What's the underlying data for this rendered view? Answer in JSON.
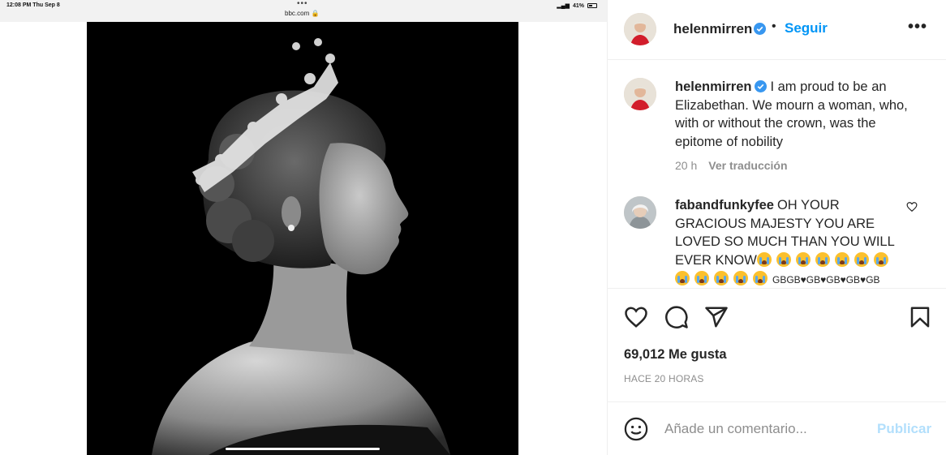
{
  "ipad": {
    "time": "12:08 PM   Thu Sep 8",
    "dots": "•••",
    "url": "bbc.com 🔒",
    "battery": "41%"
  },
  "header": {
    "username": "helenmirren",
    "bullet": "•",
    "follow_label": "Seguir",
    "more_label": "•••"
  },
  "caption": {
    "username": "helenmirren",
    "text": "I am proud to be an Elizabethan. We mourn a woman, who, with or without the crown, was the epitome of nobility",
    "time": "20 h",
    "translate_label": "Ver traducción"
  },
  "comment": {
    "username": "fabandfunkyfee",
    "text": "OH YOUR GRACIOUS MAJESTY YOU ARE LOVED SO MUCH THAN YOU WILL EVER KNOW",
    "tail": "GBGB♥GB♥GB♥GB♥GB"
  },
  "likes": "69,012 Me gusta",
  "time_ago": "HACE 20 HORAS",
  "add_comment": {
    "placeholder": "Añade un comentario...",
    "publish_label": "Publicar"
  },
  "colors": {
    "accent": "#0095f6",
    "publish_disabled": "#b2dffc",
    "text": "#262626",
    "muted": "#8e8e8e"
  }
}
